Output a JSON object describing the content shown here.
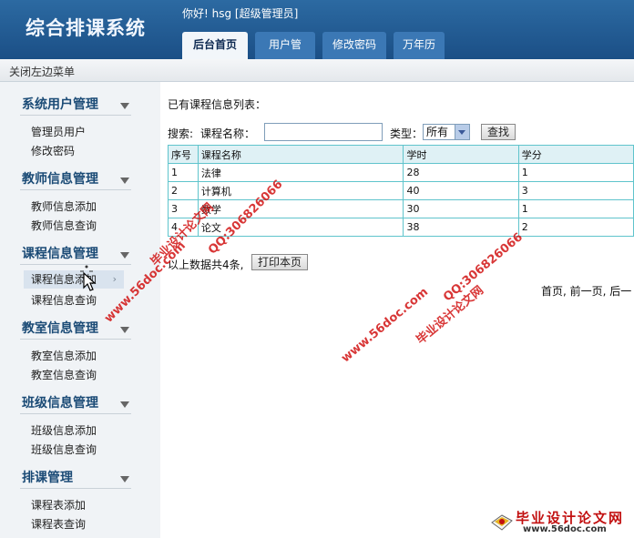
{
  "header": {
    "app_title": "综合排课系统",
    "greeting": "你好! hsg [超级管理员]",
    "tabs": [
      {
        "label": "后台首页",
        "active": true
      },
      {
        "label": "用户管理",
        "active": false
      },
      {
        "label": "修改密码",
        "active": false
      },
      {
        "label": "万年历",
        "active": false
      }
    ]
  },
  "toggle_bar": {
    "label": "关闭左边菜单"
  },
  "sidebar": {
    "sections": [
      {
        "title": "系统用户管理",
        "items": [
          "管理员用户",
          "修改密码"
        ]
      },
      {
        "title": "教师信息管理",
        "items": [
          "教师信息添加",
          "教师信息查询"
        ]
      },
      {
        "title": "课程信息管理",
        "items": [
          "课程信息添加",
          "课程信息查询"
        ]
      },
      {
        "title": "教室信息管理",
        "items": [
          "教室信息添加",
          "教室信息查询"
        ]
      },
      {
        "title": "班级信息管理",
        "items": [
          "班级信息添加",
          "班级信息查询"
        ]
      },
      {
        "title": "排课管理",
        "items": [
          "课程表添加",
          "课程表查询"
        ]
      }
    ],
    "hovered_item": "课程信息添加"
  },
  "main": {
    "list_title": "已有课程信息列表：",
    "search": {
      "label": "搜索:",
      "name_label": "课程名称：",
      "name_value": "",
      "type_label": "类型：",
      "type_selected": "所有",
      "search_button": "查找"
    },
    "table": {
      "headers": [
        "序号",
        "课程名称",
        "学时",
        "学分"
      ],
      "rows": [
        [
          "1",
          "法律",
          "28",
          "1"
        ],
        [
          "2",
          "计算机",
          "40",
          "3"
        ],
        [
          "3",
          "数学",
          "30",
          "1"
        ],
        [
          "4",
          "论文",
          "38",
          "2"
        ]
      ]
    },
    "summary": "以上数据共4条,",
    "print_button": "打印本页",
    "pager": "首页, 前一页, 后一"
  },
  "watermarks": {
    "site_name": "毕业设计论文网",
    "site_url": "www.56doc.com",
    "qq": "QQ:306826066"
  },
  "colors": {
    "header_bg": "#1b4f86",
    "sidebar_title": "#1b4b76",
    "table_border": "#5fc4cc",
    "watermark": "#d21414"
  }
}
